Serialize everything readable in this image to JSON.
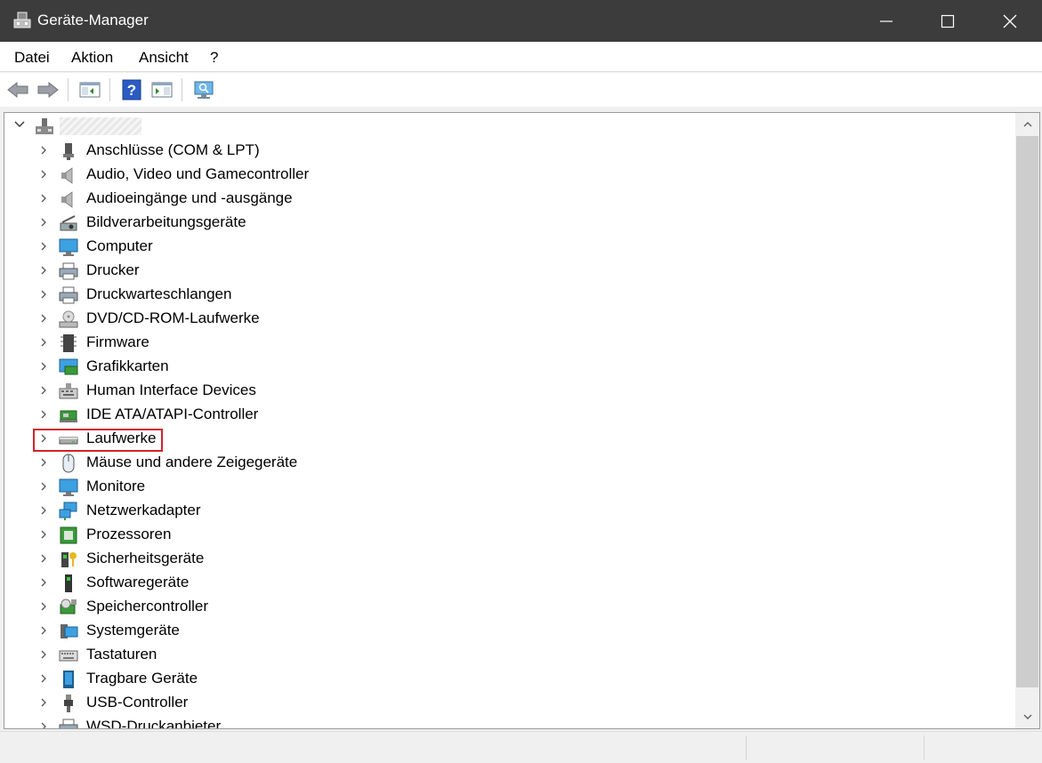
{
  "window": {
    "title": "Geräte-Manager",
    "icon": "device-manager-icon",
    "controls": [
      "minimize-icon",
      "maximize-icon",
      "close-icon"
    ]
  },
  "menu": [
    "Datei",
    "Aktion",
    "Ansicht",
    "?"
  ],
  "toolbar": [
    "back-arrow-icon",
    "forward-arrow-icon",
    "show-hide-console-tree-icon",
    "help-icon",
    "properties-pane-icon",
    "scan-hardware-icon"
  ],
  "tree": {
    "root": {
      "icon": "computer-tower-icon",
      "expanded": true
    },
    "items": [
      {
        "label": "Anschlüsse (COM & LPT)",
        "icon": "port-connector-icon"
      },
      {
        "label": "Audio, Video und Gamecontroller",
        "icon": "speaker-icon"
      },
      {
        "label": "Audioeingänge und -ausgänge",
        "icon": "speaker-icon"
      },
      {
        "label": "Bildverarbeitungsgeräte",
        "icon": "camera-scanner-icon"
      },
      {
        "label": "Computer",
        "icon": "monitor-icon"
      },
      {
        "label": "Drucker",
        "icon": "printer-icon"
      },
      {
        "label": "Druckwarteschlangen",
        "icon": "printer-icon"
      },
      {
        "label": "DVD/CD-ROM-Laufwerke",
        "icon": "optical-drive-icon"
      },
      {
        "label": "Firmware",
        "icon": "chip-icon"
      },
      {
        "label": "Grafikkarten",
        "icon": "display-adapter-icon"
      },
      {
        "label": "Human Interface Devices",
        "icon": "hid-keyboard-icon"
      },
      {
        "label": "IDE ATA/ATAPI-Controller",
        "icon": "ide-controller-icon"
      },
      {
        "label": "Laufwerke",
        "icon": "disk-drive-icon",
        "highlighted": true
      },
      {
        "label": "Mäuse und andere Zeigegeräte",
        "icon": "mouse-icon"
      },
      {
        "label": "Monitore",
        "icon": "monitor-icon"
      },
      {
        "label": "Netzwerkadapter",
        "icon": "network-adapter-icon"
      },
      {
        "label": "Prozessoren",
        "icon": "processor-icon"
      },
      {
        "label": "Sicherheitsgeräte",
        "icon": "security-key-icon"
      },
      {
        "label": "Softwaregeräte",
        "icon": "software-device-icon"
      },
      {
        "label": "Speichercontroller",
        "icon": "storage-controller-icon"
      },
      {
        "label": "Systemgeräte",
        "icon": "system-devices-icon"
      },
      {
        "label": "Tastaturen",
        "icon": "keyboard-icon"
      },
      {
        "label": "Tragbare Geräte",
        "icon": "portable-device-icon"
      },
      {
        "label": "USB-Controller",
        "icon": "usb-icon"
      },
      {
        "label": "WSD-Druckanbieter",
        "icon": "printer-icon"
      }
    ]
  },
  "colors": {
    "titlebar": "#3c3c3c",
    "highlight": "#d2232a",
    "panel_bg": "#ffffff",
    "chrome_bg": "#f0f0f0"
  }
}
